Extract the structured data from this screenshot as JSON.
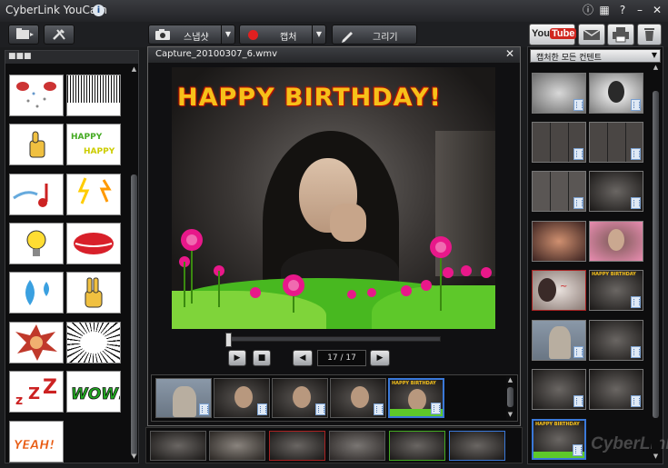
{
  "app": {
    "title": "CyberLink YouCam"
  },
  "toolbar": {
    "snapshot_label": "스냅샷",
    "capture_label": "캡처",
    "draw_label": "그리기",
    "youtube_label": "YouTube"
  },
  "left_panel": {
    "header": "■■■"
  },
  "preview": {
    "filename": "Capture_20100307_6.wmv",
    "frame_counter": "17 / 17",
    "overlay_text": "HAPPY BIRTHDAY!"
  },
  "right_panel": {
    "filter_label": "캡처한 모든 컨텐트"
  },
  "watermark": "CyberLink",
  "colors": {
    "accent_blue": "#3a78d8",
    "record_red": "#e02020",
    "youtube_red": "#d0261f"
  }
}
